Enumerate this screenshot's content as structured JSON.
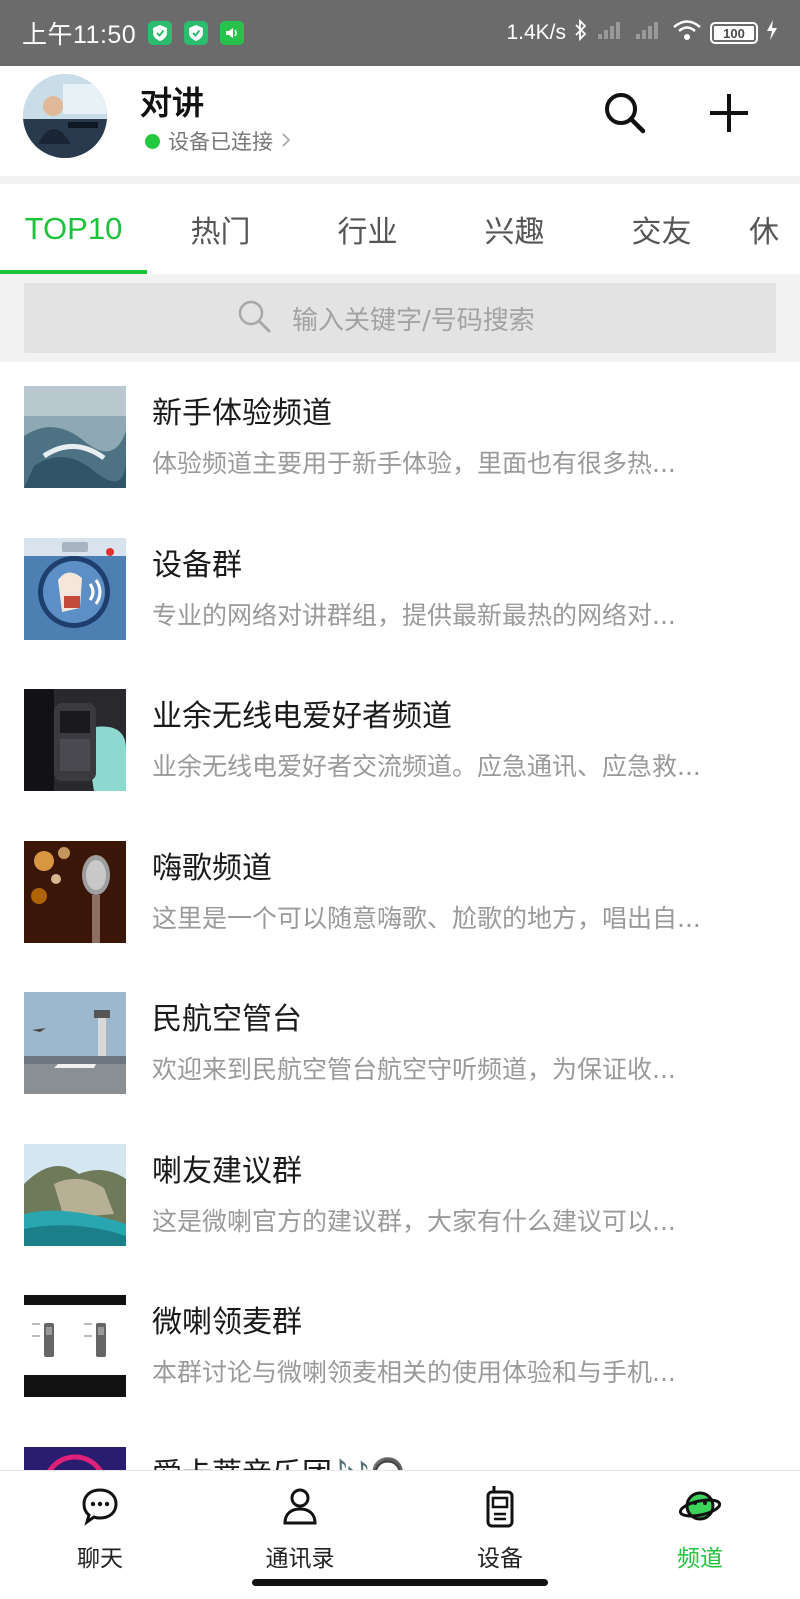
{
  "status_bar": {
    "time": "上午11:50",
    "net_speed": "1.4K/s",
    "battery": "100"
  },
  "header": {
    "title": "对讲",
    "connection_status": "设备已连接",
    "accent_color": "#22c93e"
  },
  "tabs": [
    {
      "label": "TOP10",
      "active": true
    },
    {
      "label": "热门"
    },
    {
      "label": "行业"
    },
    {
      "label": "兴趣"
    },
    {
      "label": "交友"
    },
    {
      "label": "休"
    }
  ],
  "search": {
    "placeholder": "输入关键字/号码搜索"
  },
  "channels": [
    {
      "title": "新手体验频道",
      "desc": "体验频道主要用于新手体验，里面也有很多热..."
    },
    {
      "title": "设备群",
      "desc": "专业的网络对讲群组，提供最新最热的网络对..."
    },
    {
      "title": "业余无线电爱好者频道",
      "desc": "业余无线电爱好者交流频道。应急通讯、应急救..."
    },
    {
      "title": "嗨歌频道",
      "desc": "这里是一个可以随意嗨歌、尬歌的地方，唱出自..."
    },
    {
      "title": "民航空管台",
      "desc": "欢迎来到民航空管台航空守听频道，为保证收..."
    },
    {
      "title": "喇友建议群",
      "desc": "这是微喇官方的建议群，大家有什么建议可以..."
    },
    {
      "title": "微喇领麦群",
      "desc": "本群讨论与微喇领麦相关的使用体验和与手机..."
    },
    {
      "title": "爱卡蒂音乐团🎶🎧",
      "desc": ""
    }
  ],
  "bottom_nav": [
    {
      "label": "聊天",
      "icon": "chat-bubble-icon"
    },
    {
      "label": "通讯录",
      "icon": "contacts-person-icon"
    },
    {
      "label": "设备",
      "icon": "walkie-talkie-icon"
    },
    {
      "label": "频道",
      "icon": "planet-icon",
      "active": true
    }
  ]
}
